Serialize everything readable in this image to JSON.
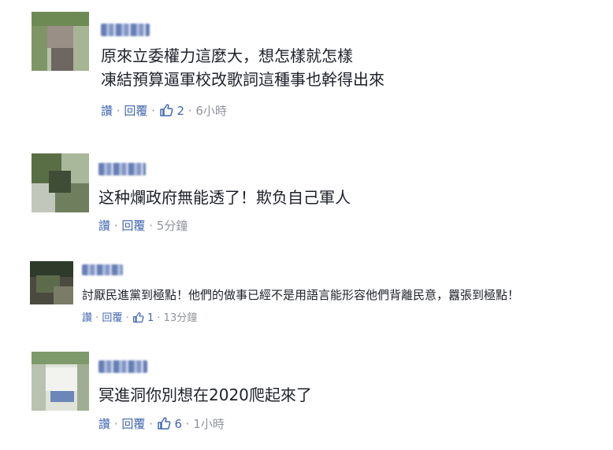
{
  "comments": [
    {
      "text": "原來立委權力這麼大，想怎樣就怎樣\n凍結預算逼軍校改歌詞這種事也幹得出來",
      "read": "讚",
      "reply": "回覆",
      "likes": "2",
      "time": "6小時"
    },
    {
      "text": "这种爛政府無能透了！欺负自己軍人",
      "read": "讚",
      "reply": "回覆",
      "time": "5分鐘"
    },
    {
      "text": "討厭民進黨到極點！他們的做事已經不是用語言能形容他們背離民意，囂張到極點！",
      "read": "讚",
      "reply": "回覆",
      "likes": "1",
      "time": "13分鐘"
    },
    {
      "text": "冥進洞你別想在2020爬起來了",
      "read": "讚",
      "reply": "回覆",
      "likes": "6",
      "time": "1小時"
    }
  ],
  "colors": {
    "link": "#4267b2",
    "meta": "#90949c",
    "text": "#1d2129"
  }
}
